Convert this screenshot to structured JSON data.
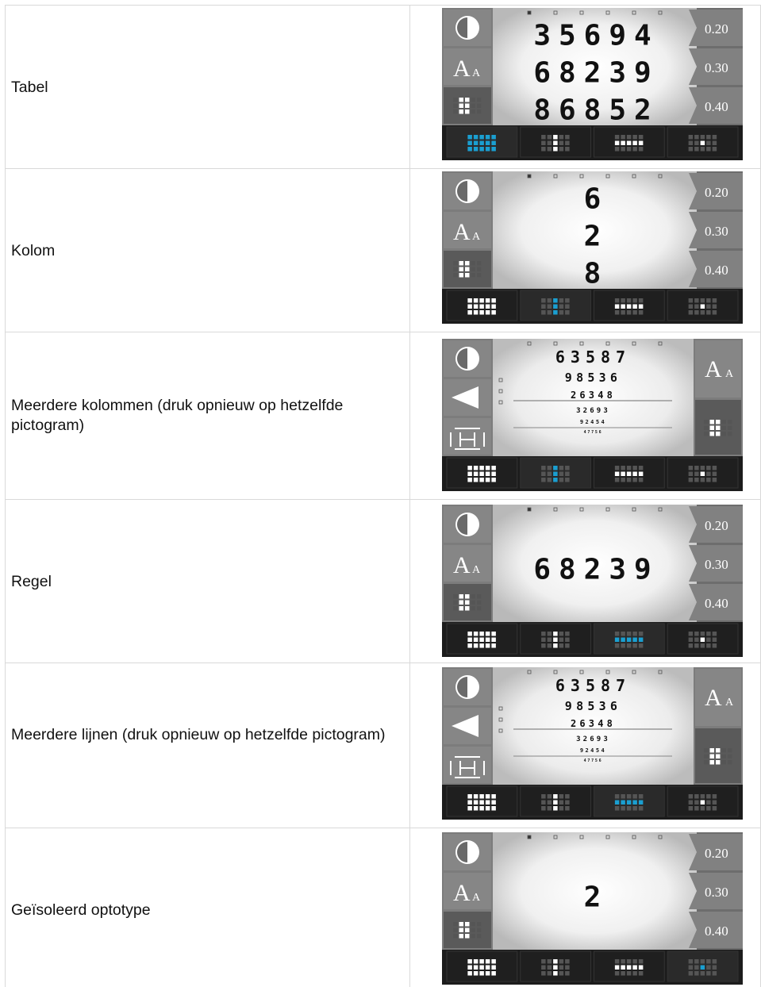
{
  "rows": [
    {
      "label": "Tabel",
      "display": {
        "lines": [
          "35694",
          "68239",
          "86852"
        ]
      }
    },
    {
      "label": "Kolom",
      "display": {
        "lines": [
          "6",
          "2",
          "8"
        ]
      }
    },
    {
      "label": "Meerdere kolommen (druk opnieuw op hetzelfde pictogram)",
      "display": {
        "lines": [
          "63587",
          "98536",
          "26348",
          "32693",
          "92454",
          "47756"
        ]
      }
    },
    {
      "label": "Regel",
      "display": {
        "lines": [
          "68239"
        ]
      }
    },
    {
      "label": "Meerdere lijnen (druk opnieuw op hetzelfde pictogram)",
      "display": {
        "lines": [
          "63587",
          "98536",
          "26348",
          "32693",
          "92454",
          "47756"
        ]
      }
    },
    {
      "label": "Geïsoleerd optotype",
      "display": {
        "lines": [
          "2"
        ]
      }
    }
  ],
  "acuity": [
    "0.20",
    "0.30",
    "0.40"
  ],
  "font_icon": {
    "big": "A",
    "small": "A"
  },
  "active_mode": [
    0,
    1,
    1,
    2,
    2,
    3
  ],
  "icons": [
    "contrast-icon",
    "font-size-icon",
    "layout-icon",
    "red-green-icon",
    "hyphen-icon"
  ]
}
